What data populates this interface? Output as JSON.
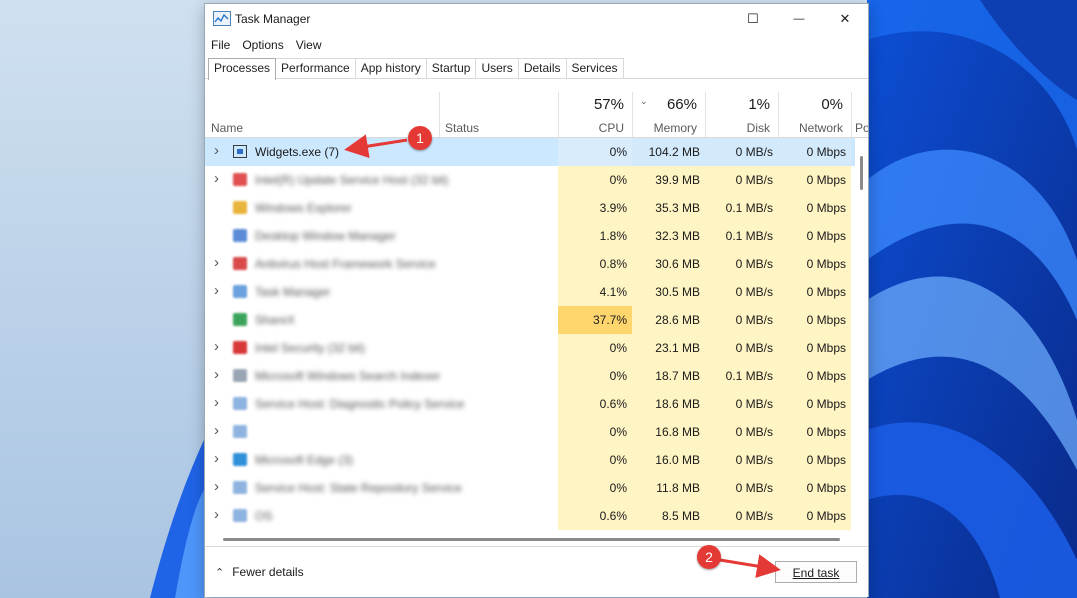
{
  "window": {
    "title": "Task Manager",
    "icon": "task-manager-icon",
    "controls": {
      "minimize": "—",
      "maximize": "☐",
      "close": "✕"
    }
  },
  "menu": [
    "File",
    "Options",
    "View"
  ],
  "tabs": [
    "Processes",
    "Performance",
    "App history",
    "Startup",
    "Users",
    "Details",
    "Services"
  ],
  "active_tab": "Processes",
  "columns": {
    "name": "Name",
    "status": "Status",
    "cpu": {
      "pct": "57%",
      "label": "CPU"
    },
    "memory": {
      "pct": "66%",
      "label": "Memory"
    },
    "disk": {
      "pct": "1%",
      "label": "Disk"
    },
    "network": {
      "pct": "0%",
      "label": "Network"
    },
    "power": "Po"
  },
  "rows": [
    {
      "name": "Widgets.exe (7)",
      "expandable": true,
      "blurred": false,
      "icon": "widgets-icon",
      "cpu": "0%",
      "mem": "104.2 MB",
      "disk": "0 MB/s",
      "net": "0 Mbps",
      "selected": true
    },
    {
      "name": "Intel(R) Update Service Host (32 bit)",
      "expandable": true,
      "blurred": true,
      "icon": "service-icon",
      "cpu": "0%",
      "mem": "39.9 MB",
      "disk": "0 MB/s",
      "net": "0 Mbps"
    },
    {
      "name": "Windows Explorer",
      "expandable": false,
      "blurred": true,
      "icon": "explorer-icon",
      "cpu": "3.9%",
      "mem": "35.3 MB",
      "disk": "0.1 MB/s",
      "net": "0 Mbps"
    },
    {
      "name": "Desktop Window Manager",
      "expandable": false,
      "blurred": true,
      "icon": "dwm-icon",
      "cpu": "1.8%",
      "mem": "32.3 MB",
      "disk": "0.1 MB/s",
      "net": "0 Mbps"
    },
    {
      "name": "Antivirus Host Framework Service",
      "expandable": true,
      "blurred": true,
      "icon": "antivirus-icon",
      "cpu": "0.8%",
      "mem": "30.6 MB",
      "disk": "0 MB/s",
      "net": "0 Mbps"
    },
    {
      "name": "Task Manager",
      "expandable": true,
      "blurred": true,
      "icon": "task-manager-icon",
      "cpu": "4.1%",
      "mem": "30.5 MB",
      "disk": "0 MB/s",
      "net": "0 Mbps"
    },
    {
      "name": "ShareX",
      "expandable": false,
      "blurred": true,
      "icon": "chrome-icon",
      "cpu": "37.7%",
      "mem": "28.6 MB",
      "disk": "0 MB/s",
      "net": "0 Mbps"
    },
    {
      "name": "Intel Security (32 bit)",
      "expandable": true,
      "blurred": true,
      "icon": "security-icon",
      "cpu": "0%",
      "mem": "23.1 MB",
      "disk": "0 MB/s",
      "net": "0 Mbps"
    },
    {
      "name": "Microsoft Windows Search Indexer",
      "expandable": true,
      "blurred": true,
      "icon": "search-indexer-icon",
      "cpu": "0%",
      "mem": "18.7 MB",
      "disk": "0.1 MB/s",
      "net": "0 Mbps"
    },
    {
      "name": "Service Host: Diagnostic Policy Service",
      "expandable": true,
      "blurred": true,
      "icon": "gear-icon",
      "cpu": "0.6%",
      "mem": "18.6 MB",
      "disk": "0 MB/s",
      "net": "0 Mbps"
    },
    {
      "name": "",
      "expandable": true,
      "blurred": true,
      "icon": "gear-icon",
      "cpu": "0%",
      "mem": "16.8 MB",
      "disk": "0 MB/s",
      "net": "0 Mbps"
    },
    {
      "name": "Microsoft Edge (3)",
      "expandable": true,
      "blurred": true,
      "icon": "edge-icon",
      "cpu": "0%",
      "mem": "16.0 MB",
      "disk": "0 MB/s",
      "net": "0 Mbps"
    },
    {
      "name": "Service Host: State Repository Service",
      "expandable": true,
      "blurred": true,
      "icon": "gear-icon",
      "cpu": "0%",
      "mem": "11.8 MB",
      "disk": "0 MB/s",
      "net": "0 Mbps"
    },
    {
      "name": "OS",
      "expandable": true,
      "blurred": true,
      "icon": "gear-icon",
      "cpu": "0.6%",
      "mem": "8.5 MB",
      "disk": "0 MB/s",
      "net": "0 Mbps"
    }
  ],
  "footer": {
    "fewer_details": "Fewer details",
    "end_task": "End task"
  },
  "annotations": {
    "badge1": "1",
    "badge2": "2"
  },
  "colors": {
    "selected_row": "#cce8ff",
    "heat_low": "#fff4c4",
    "heat_mid": "#ffe9a8",
    "heat_high": "#ffd66e",
    "annotation_red": "#e53935",
    "accent_blue": "#0a5fd1"
  }
}
